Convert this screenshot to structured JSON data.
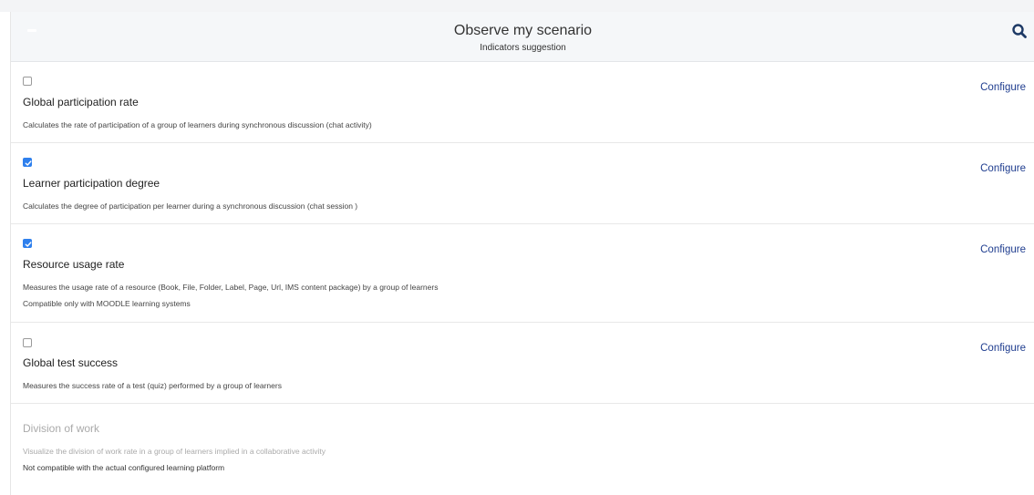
{
  "header": {
    "title": "Observe my scenario",
    "subtitle": "Indicators suggestion",
    "search_icon": "search-icon"
  },
  "indicators": [
    {
      "title": "Global participation rate",
      "description": "Calculates the rate of participation of a group of learners during synchronous discussion (chat activity)",
      "checked": false,
      "configure_label": "Configure"
    },
    {
      "title": "Learner participation degree",
      "description": "Calculates the degree of participation per learner during a synchronous discussion (chat session )",
      "checked": true,
      "configure_label": "Configure"
    },
    {
      "title": "Resource usage rate",
      "description": "Measures the usage rate of a resource (Book, File, Folder, Label, Page, Url, IMS content package) by a group of learners",
      "note": "Compatible only with MOODLE learning systems",
      "checked": true,
      "configure_label": "Configure"
    },
    {
      "title": "Global test success",
      "description": "Measures the success rate of a test (quiz) performed by a group of learners",
      "checked": false,
      "configure_label": "Configure"
    },
    {
      "title": "Division of work",
      "description": "Visualize the division of work rate in a group of learners implied in a collaborative activity",
      "note": "Not compatible with the actual configured learning platform",
      "disabled": true
    }
  ],
  "colors": {
    "accent": "#2f80ed",
    "link": "#1f3d8f",
    "header_bg": "#f5f7f9"
  }
}
